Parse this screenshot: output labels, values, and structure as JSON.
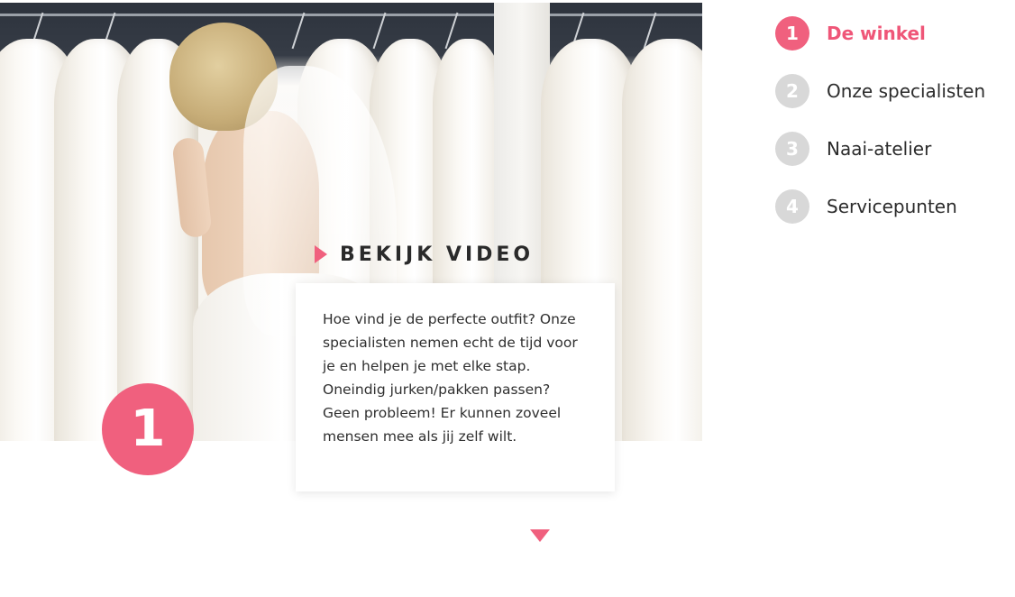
{
  "hero": {
    "step_number": "1",
    "video_label": "BEKIJK VIDEO",
    "description": "Hoe vind je de perfecte outfit? Onze specialisten nemen echt de tijd voor je en helpen je met elke stap. Oneindig jurken/pakken passen? Geen probleem! Er kunnen zoveel mensen mee als jij zelf wilt."
  },
  "steps": [
    {
      "number": "1",
      "label": "De winkel",
      "active": true
    },
    {
      "number": "2",
      "label": "Onze specialisten",
      "active": false
    },
    {
      "number": "3",
      "label": "Naai-atelier",
      "active": false
    },
    {
      "number": "4",
      "label": "Servicepunten",
      "active": false
    }
  ],
  "icons": {
    "play": "play-icon",
    "scroll_down": "chevron-down-icon"
  },
  "colors": {
    "accent": "#f0607e",
    "inactive_step": "#d8d8d8",
    "text": "#2c2c2c"
  }
}
